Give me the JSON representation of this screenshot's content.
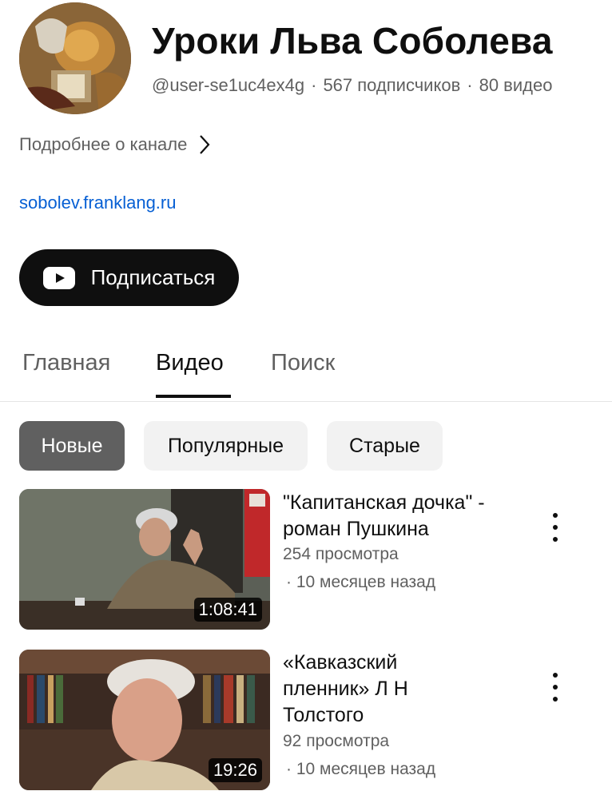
{
  "channel": {
    "title": "Уроки Льва Соболева",
    "handle": "@user-se1uc4ex4g",
    "subscribers": "567 подписчиков",
    "videos_count": "80 видео",
    "more_label": "Подробнее о канале",
    "link": "sobolev.franklang.ru",
    "subscribe_label": "Подписаться"
  },
  "tabs": [
    {
      "label": "Главная"
    },
    {
      "label": "Видео"
    },
    {
      "label": "Поиск"
    }
  ],
  "chips": [
    {
      "label": "Новые"
    },
    {
      "label": "Популярные"
    },
    {
      "label": "Старые"
    }
  ],
  "videos": [
    {
      "title": "\"Капитанская дочка\" - роман Пушкина",
      "views": "254 просмотра",
      "age": "· 10 месяцев назад",
      "duration": "1:08:41"
    },
    {
      "title": "«Кавказский пленник» Л Н Толстого",
      "views": "92 просмотра",
      "age": "· 10 месяцев назад",
      "duration": "19:26"
    }
  ],
  "colors": {
    "link": "#065fd4",
    "secondary_text": "#606060",
    "subscribe_bg": "#0f0f0f",
    "chip_active_bg": "#606060",
    "chip_bg": "#f2f2f2"
  },
  "icons": [
    "youtube-play-icon",
    "chevron-right-icon",
    "more-vertical-icon"
  ]
}
